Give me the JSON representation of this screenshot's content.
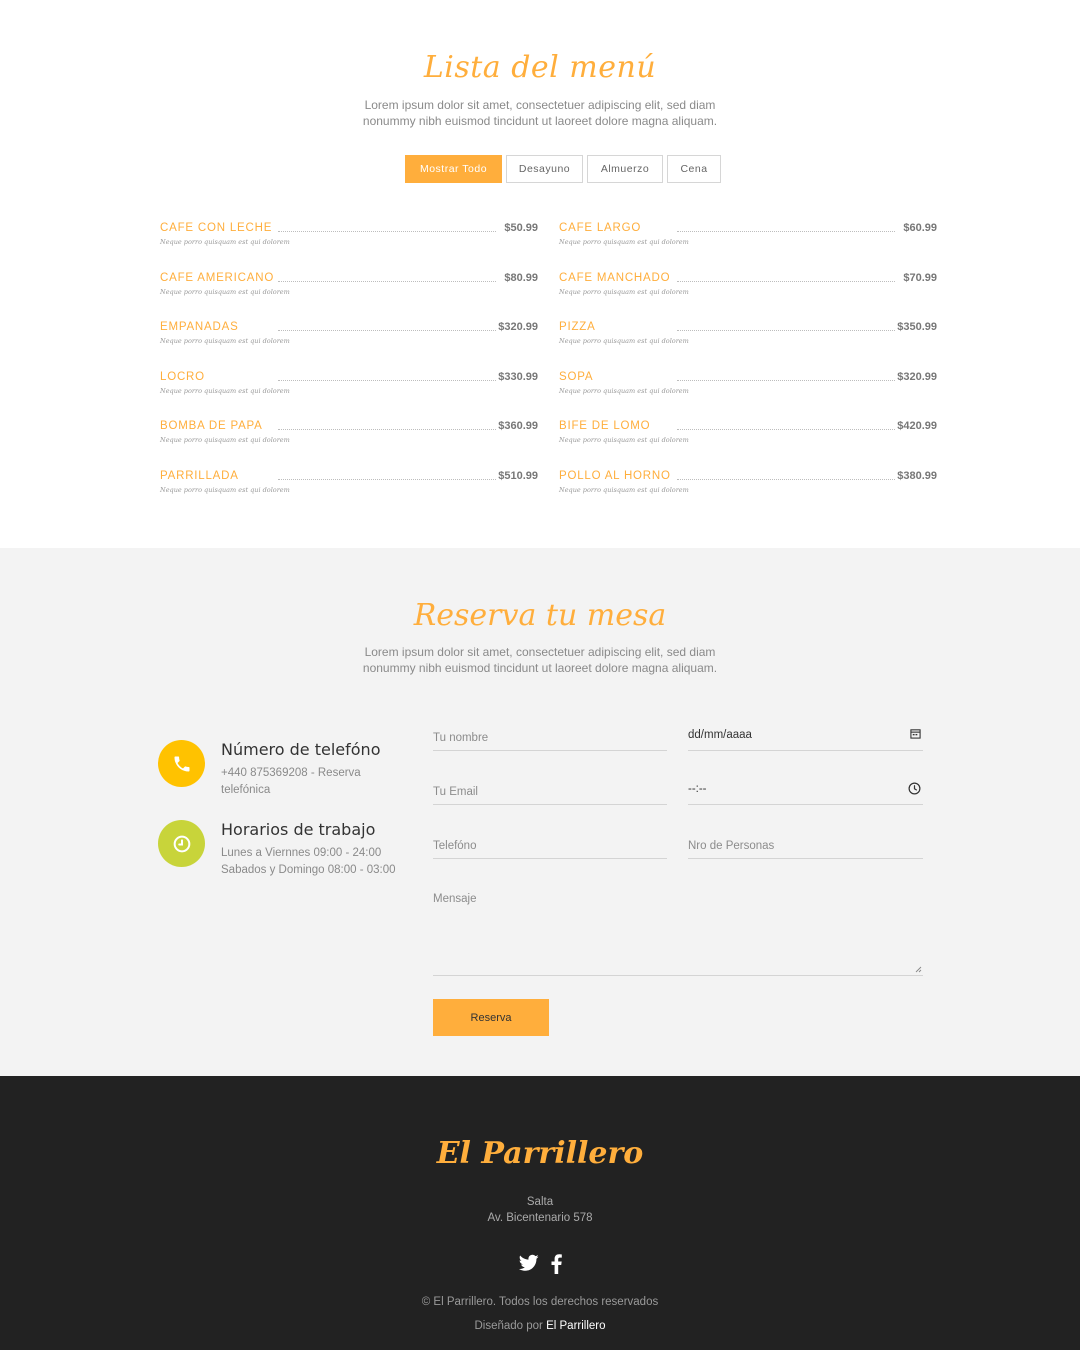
{
  "menu": {
    "title": "Lista del menú",
    "subtitle": "Lorem ipsum dolor sit amet, consectetuer adipiscing elit, sed diam nonummy nibh euismod tincidunt ut laoreet dolore magna aliquam.",
    "filters": [
      "Mostrar Todo",
      "Desayuno",
      "Almuerzo",
      "Cena"
    ],
    "active_filter": "Mostrar Todo",
    "items": [
      {
        "name": "CAFE CON LECHE",
        "price": "$50.99",
        "desc": "Neque porro quisquam est qui dolorem"
      },
      {
        "name": "CAFE LARGO",
        "price": "$60.99",
        "desc": "Neque porro quisquam est qui dolorem"
      },
      {
        "name": "CAFE AMERICANO",
        "price": "$80.99",
        "desc": "Neque porro quisquam est qui dolorem"
      },
      {
        "name": "CAFE MANCHADO",
        "price": "$70.99",
        "desc": "Neque porro quisquam est qui dolorem"
      },
      {
        "name": "EMPANADAS",
        "price": "$320.99",
        "desc": "Neque porro quisquam est qui dolorem"
      },
      {
        "name": "PIZZA",
        "price": "$350.99",
        "desc": "Neque porro quisquam est qui dolorem"
      },
      {
        "name": "LOCRO",
        "price": "$330.99",
        "desc": "Neque porro quisquam est qui dolorem"
      },
      {
        "name": "SOPA",
        "price": "$320.99",
        "desc": "Neque porro quisquam est qui dolorem"
      },
      {
        "name": "BOMBA DE PAPA",
        "price": "$360.99",
        "desc": "Neque porro quisquam est qui dolorem"
      },
      {
        "name": "BIFE DE LOMO",
        "price": "$420.99",
        "desc": "Neque porro quisquam est qui dolorem"
      },
      {
        "name": "PARRILLADA",
        "price": "$510.99",
        "desc": "Neque porro quisquam est qui dolorem"
      },
      {
        "name": "POLLO AL HORNO",
        "price": "$380.99",
        "desc": "Neque porro quisquam est qui dolorem"
      }
    ]
  },
  "reservation": {
    "title": "Reserva tu mesa",
    "subtitle": "Lorem ipsum dolor sit amet, consectetuer adipiscing elit, sed diam nonummy nibh euismod tincidunt ut laoreet dolore magna aliquam.",
    "phone": {
      "title": "Número de telefóno",
      "text": "+440 875369208 - Reserva telefónica",
      "icon": "phone-icon",
      "color": "#ffc200"
    },
    "hours": {
      "title": "Horarios de trabajo",
      "line1": "Lunes a Viernnes 09:00 - 24:00",
      "line2": "Sabados y Domingo 08:00 - 03:00",
      "icon": "clock-icon",
      "color": "#c8d43a"
    },
    "form": {
      "name_placeholder": "Tu nombre",
      "email_placeholder": "Tu Email",
      "phone_placeholder": "Telefóno",
      "date_value": "dd/mm/aaaa",
      "time_value": "--:--",
      "persons_placeholder": "Nro de Personas",
      "message_placeholder": "Mensaje",
      "submit_label": "Reserva"
    }
  },
  "footer": {
    "brand": "El Parrillero",
    "city": "Salta",
    "address": "Av. Bicentenario 578",
    "social": [
      "twitter-icon",
      "facebook-icon"
    ],
    "copyright": "© El Parrillero. Todos los derechos reservados",
    "designed_prefix": "Diseñado por",
    "designed_by": "El Parrillero"
  },
  "colors": {
    "accent": "#ffae3c",
    "footer_bg": "#222222",
    "section_bg": "#f3f3f3"
  }
}
